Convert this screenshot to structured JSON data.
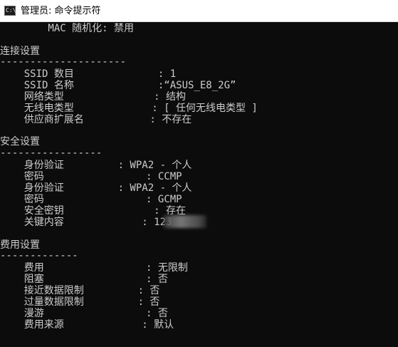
{
  "window": {
    "title": "管理员: 命令提示符",
    "icon_text": "C:\\"
  },
  "console": {
    "lines": [
      "        MAC 随机化: 禁用",
      "连接设置",
      "---------------------",
      "    SSID 数目              : 1",
      "    SSID 名称              :“ASUS_E8_2G”",
      "    网络类型               : 结构",
      "    无线电类型             : [ 任何无线电类型 ]",
      "    供应商扩展名           : 不存在",
      "安全设置",
      "-----------------",
      "    身份验证         : WPA2 - 个人",
      "    密码                 : CCMP",
      "    身份验证         : WPA2 - 个人",
      "    密码                 : GCMP",
      "    安全密钥               : 存在",
      "    关键内容             : 123",
      "费用设置",
      "-------------",
      "    费用                 : 无限制",
      "    阻塞                 : 否",
      "    接近数据限制         : 否",
      "    过量数据限制         : 否",
      "    漫游                 : 否",
      "    费用来源             : 默认"
    ]
  }
}
